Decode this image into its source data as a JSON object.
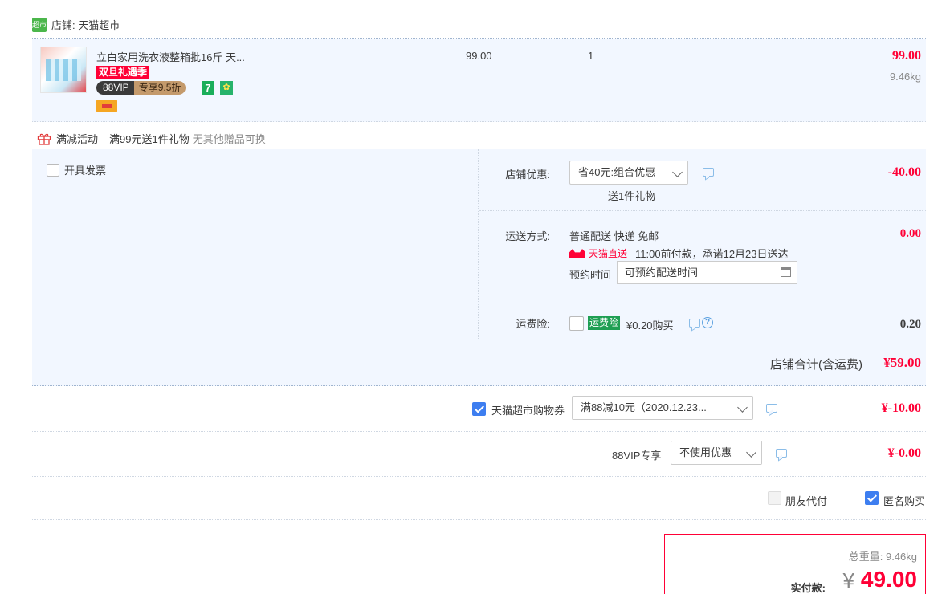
{
  "shop": {
    "icon_text": "超市",
    "label": "店铺: 天猫超市"
  },
  "item": {
    "title": "立白家用洗衣液整箱批16斤 天...",
    "sale_tag": "双旦礼遇季",
    "vip_tag_a": "88VIP",
    "vip_tag_b": "专享9.5折",
    "icon_7": "7",
    "unit_price": "99.00",
    "quantity": "1",
    "subtotal": "99.00",
    "weight": "9.46kg"
  },
  "promo": {
    "type": "满减活动",
    "desc": "满99元送1件礼物",
    "note": "无其他赠品可换"
  },
  "invoice": {
    "label": "开具发票"
  },
  "shop_discount": {
    "label": "店铺优惠:",
    "selected": "省40元:组合优惠",
    "sub": "送1件礼物",
    "value": "-40.00"
  },
  "shipping": {
    "label": "运送方式:",
    "method": "普通配送 快递 免邮",
    "badge": "天猫直送",
    "promise": "11:00前付款，承诺12月23日送达",
    "appoint_label": "预约时间",
    "appoint_placeholder": "可预约配送时间",
    "value": "0.00"
  },
  "insurance": {
    "label": "运费险:",
    "tag": "运费险",
    "price": "¥0.20购买",
    "value": "0.20"
  },
  "shop_total": {
    "label": "店铺合计(含运费)",
    "value": "¥59.00"
  },
  "coupon": {
    "label": "天猫超市购物券",
    "selected": "满88减10元（2020.12.23...",
    "value": "¥-10.00"
  },
  "vip": {
    "label": "88VIP专享",
    "selected": "不使用优惠",
    "value": "¥-0.00"
  },
  "options": {
    "friend_pay": "朋友代付",
    "anonymous": "匿名购买"
  },
  "payment": {
    "weight_text": "总重量: 9.46kg",
    "label": "实付款:",
    "currency": "¥",
    "amount": "49.00"
  },
  "colors": {
    "accent": "#ff0036",
    "panel_bg": "#f2f7ff",
    "checkbox": "#3d7ef0"
  }
}
